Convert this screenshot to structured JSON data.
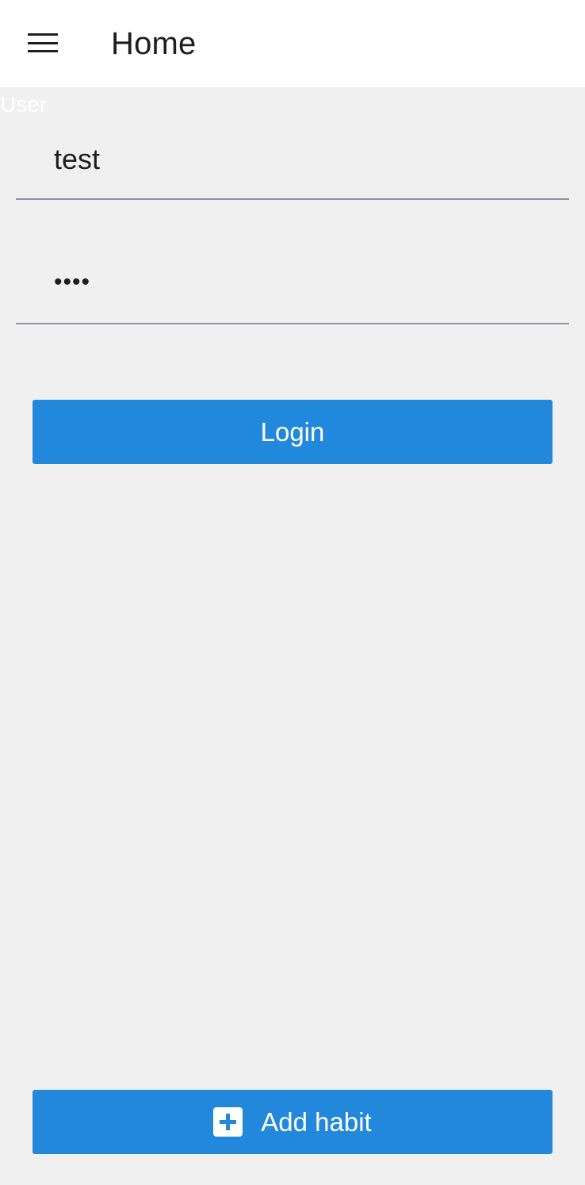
{
  "app_bar": {
    "title": "Home",
    "menu_icon": "hamburger-menu-icon"
  },
  "login_form": {
    "user_caption": "User",
    "username": {
      "value": "test"
    },
    "password": {
      "value": "test"
    },
    "login_label": "Login"
  },
  "footer": {
    "add_habit_label": "Add habit",
    "add_icon": "plus-box-icon"
  },
  "colors": {
    "accent": "#2288dc",
    "background": "#f0f0f0",
    "app_bar": "#ffffff",
    "divider": "#8c96a0",
    "text": "#1e1e1e"
  }
}
